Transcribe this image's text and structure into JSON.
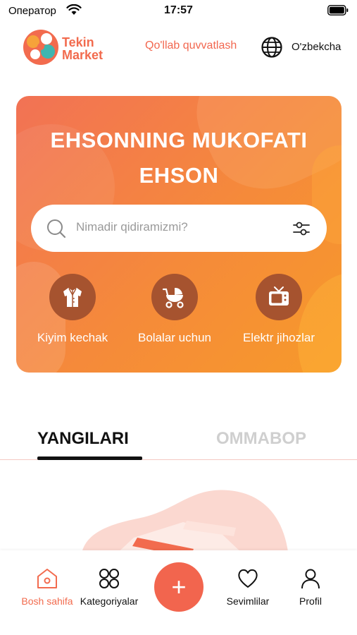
{
  "status_bar": {
    "carrier": "Оператор",
    "time": "17:57"
  },
  "header": {
    "logo_line1": "Tekin",
    "logo_line2": "Market",
    "support_link": "Qo'llab quvvatlash",
    "language": "O'zbekcha"
  },
  "banner": {
    "title_line1": "EHSONNING MUKOFATI",
    "title_line2": "EHSON",
    "search_placeholder": "Nimadir qidiramizmi?",
    "categories": [
      {
        "label": "Kiyim kechak",
        "icon": "clothing-icon"
      },
      {
        "label": "Bolalar uchun",
        "icon": "stroller-icon"
      },
      {
        "label": "Elektr jihozlar",
        "icon": "tv-icon"
      }
    ]
  },
  "tabs": {
    "new": "YANGILARI",
    "popular": "OMMABOP",
    "active": "new"
  },
  "bottom_nav": {
    "home": "Bosh sahifa",
    "categories": "Kategoriyalar",
    "add": "+",
    "favorites": "Sevimlilar",
    "profile": "Profil"
  },
  "colors": {
    "accent": "#f26b4e",
    "banner_start": "#f27255",
    "banner_end": "#f79a2a",
    "category_circle": "#a6532f"
  }
}
